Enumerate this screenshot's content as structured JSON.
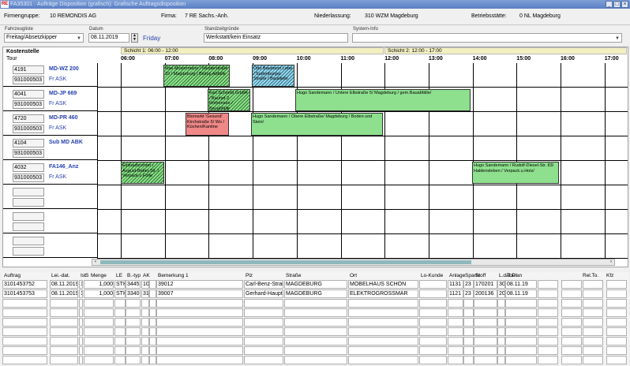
{
  "window": {
    "title": "FA35301 · Aufträge Disposition (grafisch): Grafische Auftragsdisposition",
    "logo": "RE"
  },
  "info": {
    "firmengruppe_label": "Firmengruppe:",
    "firmengruppe": "10 REMONDIS AG",
    "firma_label": "Firma:",
    "firma": "7 RE Sachs.-Anh.",
    "niederlassung_label": "Niederlassung:",
    "niederlassung": "310 WZM Magdeburg",
    "betriebsstaette_label": "Betriebsstätte:",
    "betriebsstaette": "0 NL Magdeburg"
  },
  "filters": {
    "fahrzeugliste_label": "Fahrzeugliste",
    "fahrzeugliste": "Freitag/Absetzkipper",
    "datum_label": "Datum",
    "datum": "08.11.2019",
    "weekday": "Friday",
    "standzeit_label": "Standzeitgründe",
    "standzeit": "Werkstatt/kein Einsatz",
    "sysinfo_label": "System-Info",
    "sysinfo": ""
  },
  "timeline": {
    "kostenstelle": "Kostenstelle",
    "tour": "Tour",
    "shift1": "Schicht 1: 06:00 - 12:00",
    "shift2": "Schicht 2: 12:00 - 17:00",
    "hours": [
      "06:00",
      "07:00",
      "08:00",
      "09:00",
      "10:00",
      "11:00",
      "12:00",
      "13:00",
      "14:00",
      "15:00",
      "16:00",
      "17:00"
    ],
    "rows": [
      {
        "code": "4191",
        "tour": "931000503",
        "name": "MD-WZ 200",
        "sub": "Fr ASK"
      },
      {
        "code": "4041",
        "tour": "931000503",
        "name": "MD-JP 669",
        "sub": "Fr ASK"
      },
      {
        "code": "4720",
        "tour": "931000503",
        "name": "MD-PR 460",
        "sub": "Fr ASK"
      },
      {
        "code": "4104",
        "tour": "931000503",
        "name": "Sub MD ABK",
        "sub": ""
      },
      {
        "code": "4032",
        "tour": "931000503",
        "name": "FA146_Anz",
        "sub": "Fr ASK"
      }
    ],
    "jobs": [
      {
        "text": "Max Mustermann / Musterstraße 10 / Magdeburg / Biotop Abfälle"
      },
      {
        "text": "Otto Baumann Lebe / Sudenburger Straße / Baustelle"
      },
      {
        "text": "Karl Schmidt GmbH / Bauhof 2 Rothensee / Bauabfälle"
      },
      {
        "text": "Hugo Sandemann / Untere Elbstraße 5/ Magdeburg / gem.Bauabfälle/"
      },
      {
        "text": "Biomarkt 'Gesund' Kirchstraße 5/ Wo / Küchen/Kantine"
      },
      {
        "text": "Hugo Sandemann / Obere Elbstraße/ Magdeburg / Boden und Stein/"
      },
      {
        "text": "Einkaufscenter / August-Bebel-Str. / Verpack.u.Folie"
      },
      {
        "text": "Hugo Sandemann / Rudolf-Diesel-Str. 83/ Haldensleben / Verpack.u.Holz/"
      }
    ]
  },
  "table": {
    "headers": [
      "Auftrag",
      "Lei.-dat.",
      "Ist",
      "S",
      "Menge",
      "LE",
      "B.-typ",
      "AK",
      "Bemerkung 1",
      "Plz",
      "Straße",
      "Ort",
      "Lo-Kunde",
      "Anlage",
      "Sparte",
      "Stoff",
      "L.dat.Plan",
      "Tour",
      "Rel.To.",
      "Kfz"
    ],
    "rows": [
      [
        "3101453752",
        "08.11.2019",
        "1",
        "1,000",
        "STK",
        "3445",
        "10",
        "",
        "39012",
        "Carl-Benz-Straße 5",
        "MAGDEBURG",
        "MÖBELHAUS SCHÖN",
        "",
        "1131",
        "23",
        "170201",
        "30",
        "08.11.19"
      ],
      [
        "3101453753",
        "08.11.2019",
        "1",
        "1,000",
        "STK",
        "3340",
        "31",
        "",
        "39007",
        "Gerhard-Hauptmann-Pla",
        "MAGDEBURG",
        "ELEKTROGROSSMAR",
        "",
        "1121",
        "23",
        "200136",
        "20",
        "08.11.19"
      ]
    ]
  }
}
